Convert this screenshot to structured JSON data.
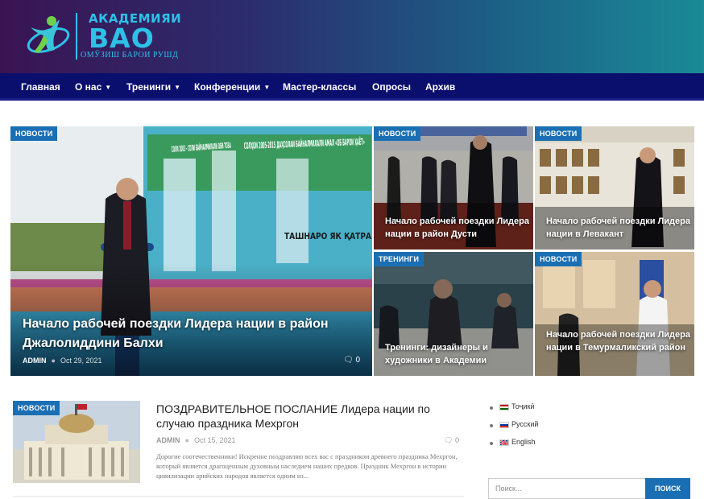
{
  "header": {
    "logo_line1": "АКАДЕМИЯИ",
    "logo_line2": "ВАО",
    "logo_line3": "ОМӮЗИШ БАРОИ РУШД"
  },
  "nav": {
    "items": [
      {
        "label": "Главная",
        "has_dropdown": false
      },
      {
        "label": "О нас",
        "has_dropdown": true
      },
      {
        "label": "Тренинги",
        "has_dropdown": true
      },
      {
        "label": "Конференции",
        "has_dropdown": true
      },
      {
        "label": "Мастер-классы",
        "has_dropdown": false
      },
      {
        "label": "Опросы",
        "has_dropdown": false
      },
      {
        "label": "Архив",
        "has_dropdown": false
      }
    ]
  },
  "featured": {
    "main": {
      "badge": "НОВОСТИ",
      "title": "Начало рабочей поездки Лидера нации в район Джалолиддини Балхи",
      "author": "ADMIN",
      "date": "Oct 29, 2021",
      "comments": "0",
      "photo_text": {
        "banner_left": "СОЛИ 2003 - СОЛИ БАЙНАЛМИЛАЛИ ОБИ ТОЗА",
        "banner_right": "СОЛҲОИ 2005-2015 ДАҲСОЛАИ БАЙНАЛМИЛАЛИ АМАЛ «ОБ БАРОИ ҲАЁТ»",
        "banner_bottom": "ТАШНАРО ЯК ҚАТРА"
      }
    },
    "small": [
      {
        "badge": "НОВОСТИ",
        "title": "Начало рабочей поездки Лидера нации в район Дусти"
      },
      {
        "badge": "НОВОСТИ",
        "title": "Начало рабочей поездки Лидера нации в Левакант"
      },
      {
        "badge": "ТРЕНИНГИ",
        "title": "Тренинги: дизайнеры и художники в Академии"
      },
      {
        "badge": "НОВОСТИ",
        "title": "Начало рабочей поездки Лидера нации в Темурмаликский район"
      }
    ]
  },
  "article": {
    "badge": "НОВОСТИ",
    "title": "ПОЗДРАВИТЕЛЬНОЕ ПОСЛАНИЕ Лидера нации по случаю праздника Мехргон",
    "author": "ADMIN",
    "date": "Oct 15, 2021",
    "comments": "0",
    "excerpt": "Дорогие соотечественники! Искренне поздравляю всех вас с праздником древнего праздника Мехргон, который является драгоценным духовным наследием наших предков. Праздник Мехргон в истории цивилизации арийских народов является одним из..."
  },
  "sidebar": {
    "languages": [
      {
        "label": "Тоҷикӣ",
        "flag": "tj"
      },
      {
        "label": "Русский",
        "flag": "ru"
      },
      {
        "label": "English",
        "flag": "gb"
      }
    ],
    "search_placeholder": "Поиск...",
    "search_button": "ПОИСК"
  },
  "colors": {
    "nav_bg": "#0a0f6e",
    "badge_bg": "#1a6fb4",
    "accent": "#2ec1e8"
  }
}
